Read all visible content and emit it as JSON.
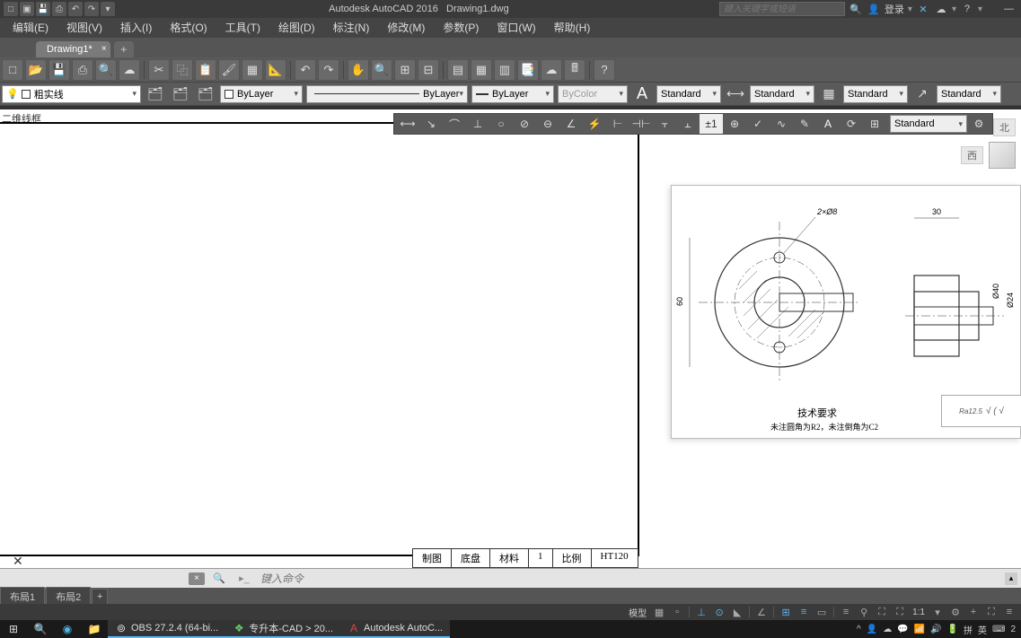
{
  "title": {
    "app": "Autodesk AutoCAD 2016",
    "file": "Drawing1.dwg"
  },
  "search": {
    "placeholder": "键入关键字或短语"
  },
  "login": {
    "label": "登录"
  },
  "menu": [
    "编辑(E)",
    "视图(V)",
    "插入(I)",
    "格式(O)",
    "工具(T)",
    "绘图(D)",
    "标注(N)",
    "修改(M)",
    "参数(P)",
    "窗口(W)",
    "帮助(H)"
  ],
  "tabs": {
    "active": "Drawing1*"
  },
  "layer": {
    "current": "粗实线"
  },
  "props": {
    "color": "ByLayer",
    "linetype": "ByLayer",
    "lineweight": "ByLayer",
    "plotstyle": "ByColor"
  },
  "styles": {
    "text": "Standard",
    "dim": "Standard",
    "table": "Standard",
    "mleader": "Standard",
    "dim_combo": "Standard"
  },
  "vp_label": "二维线框",
  "nav": {
    "top": "北",
    "west": "西"
  },
  "ref_drawing": {
    "hole_note": "2×Ø8",
    "dim_width": "30",
    "dim_v60": "60",
    "dim_phi40": "Ø40",
    "dim_phi24": "Ø24",
    "surface": "Ra12.5",
    "surface_symbol": "√  ( √",
    "tech_title": "技术要求",
    "tech_body": "未注圆角为R2，未注倒角为C2"
  },
  "title_block": [
    "制图",
    "底盘",
    "材料",
    "1",
    "比例",
    "HT120"
  ],
  "cmd": {
    "placeholder": "键入命令"
  },
  "layouts": [
    "布局1",
    "布局2"
  ],
  "status": {
    "model": "模型",
    "scale": "1:1"
  },
  "taskbar": {
    "obs": "OBS 27.2.4 (64-bi...",
    "cad": "专升本-CAD > 20...",
    "acad": "Autodesk AutoC..."
  },
  "tray": {
    "ime1": "拼",
    "ime2": "英",
    "time": "2"
  }
}
